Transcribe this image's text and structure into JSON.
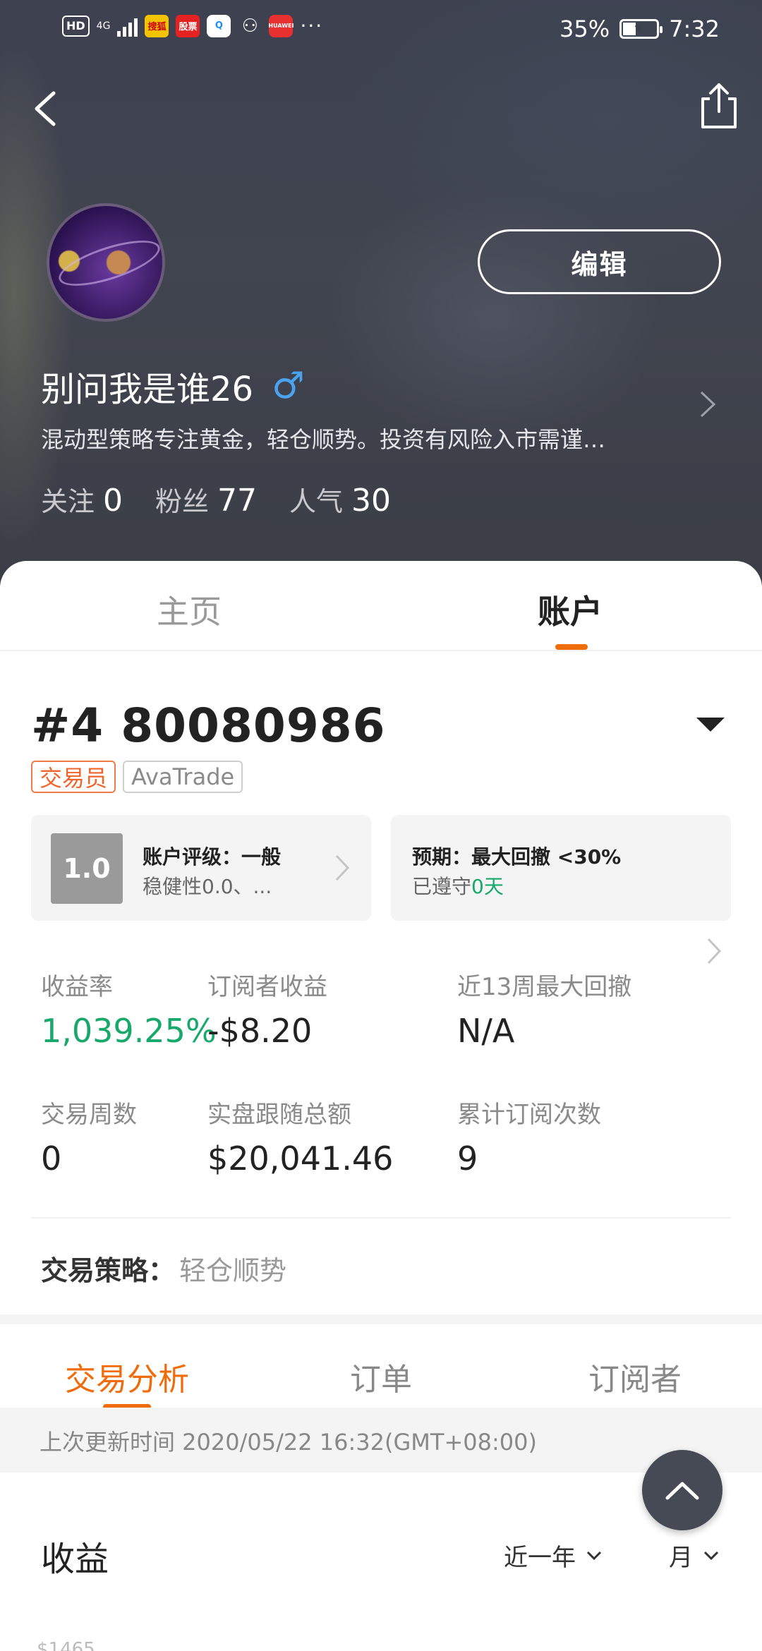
{
  "status_bar": {
    "left_badges": [
      "HD",
      "4G",
      "搜狐",
      "股票",
      "Q",
      "⚇",
      "HUAWEI"
    ],
    "more": "···",
    "battery": "35%",
    "battery_level": 0.35,
    "time": "7:32"
  },
  "profile": {
    "username": "别问我是谁26",
    "gender": "♂",
    "bio": "混动型策略专注黄金，轻仓顺势。投资有风险入市需谨…",
    "edit_label": "编辑",
    "stats": [
      {
        "label": "关注",
        "value": "0"
      },
      {
        "label": "粉丝",
        "value": "77"
      },
      {
        "label": "人气",
        "value": "30"
      }
    ]
  },
  "tabs_top": {
    "home": "主页",
    "account": "账户"
  },
  "account": {
    "id": "#4 80080986",
    "badge_trader": "交易员",
    "badge_broker": "AvaTrade",
    "rating_score": "1.0",
    "rating_title": "账户评级：一般",
    "rating_sub": "稳健性0.0、...",
    "expect_title": "预期：最大回撤 <30%",
    "expect_sub_prefix": "已遵守",
    "expect_sub_value": "0天"
  },
  "metrics": [
    {
      "label": "收益率",
      "value": "1,039.25%"
    },
    {
      "label": "订阅者收益",
      "value": "-$8.20"
    },
    {
      "label": "近13周最大回撤",
      "value": "N/A"
    },
    {
      "label": "交易周数",
      "value": "0"
    },
    {
      "label": "实盘跟随总额",
      "value": "$20,041.46"
    },
    {
      "label": "累计订阅次数",
      "value": "9"
    }
  ],
  "strategy": {
    "label": "交易策略：",
    "value": "轻仓顺势"
  },
  "tabs_sub": {
    "analysis": "交易分析",
    "orders": "订单",
    "subscribers": "订阅者"
  },
  "update": {
    "text": "上次更新时间 2020/05/22 16:32(GMT+08:00)"
  },
  "earnings": {
    "title": "收益",
    "period": "近一年",
    "unit": "月",
    "y_top_label": "$1465"
  },
  "colors": {
    "accent": "#f06c0a",
    "positive": "#18a86b"
  }
}
